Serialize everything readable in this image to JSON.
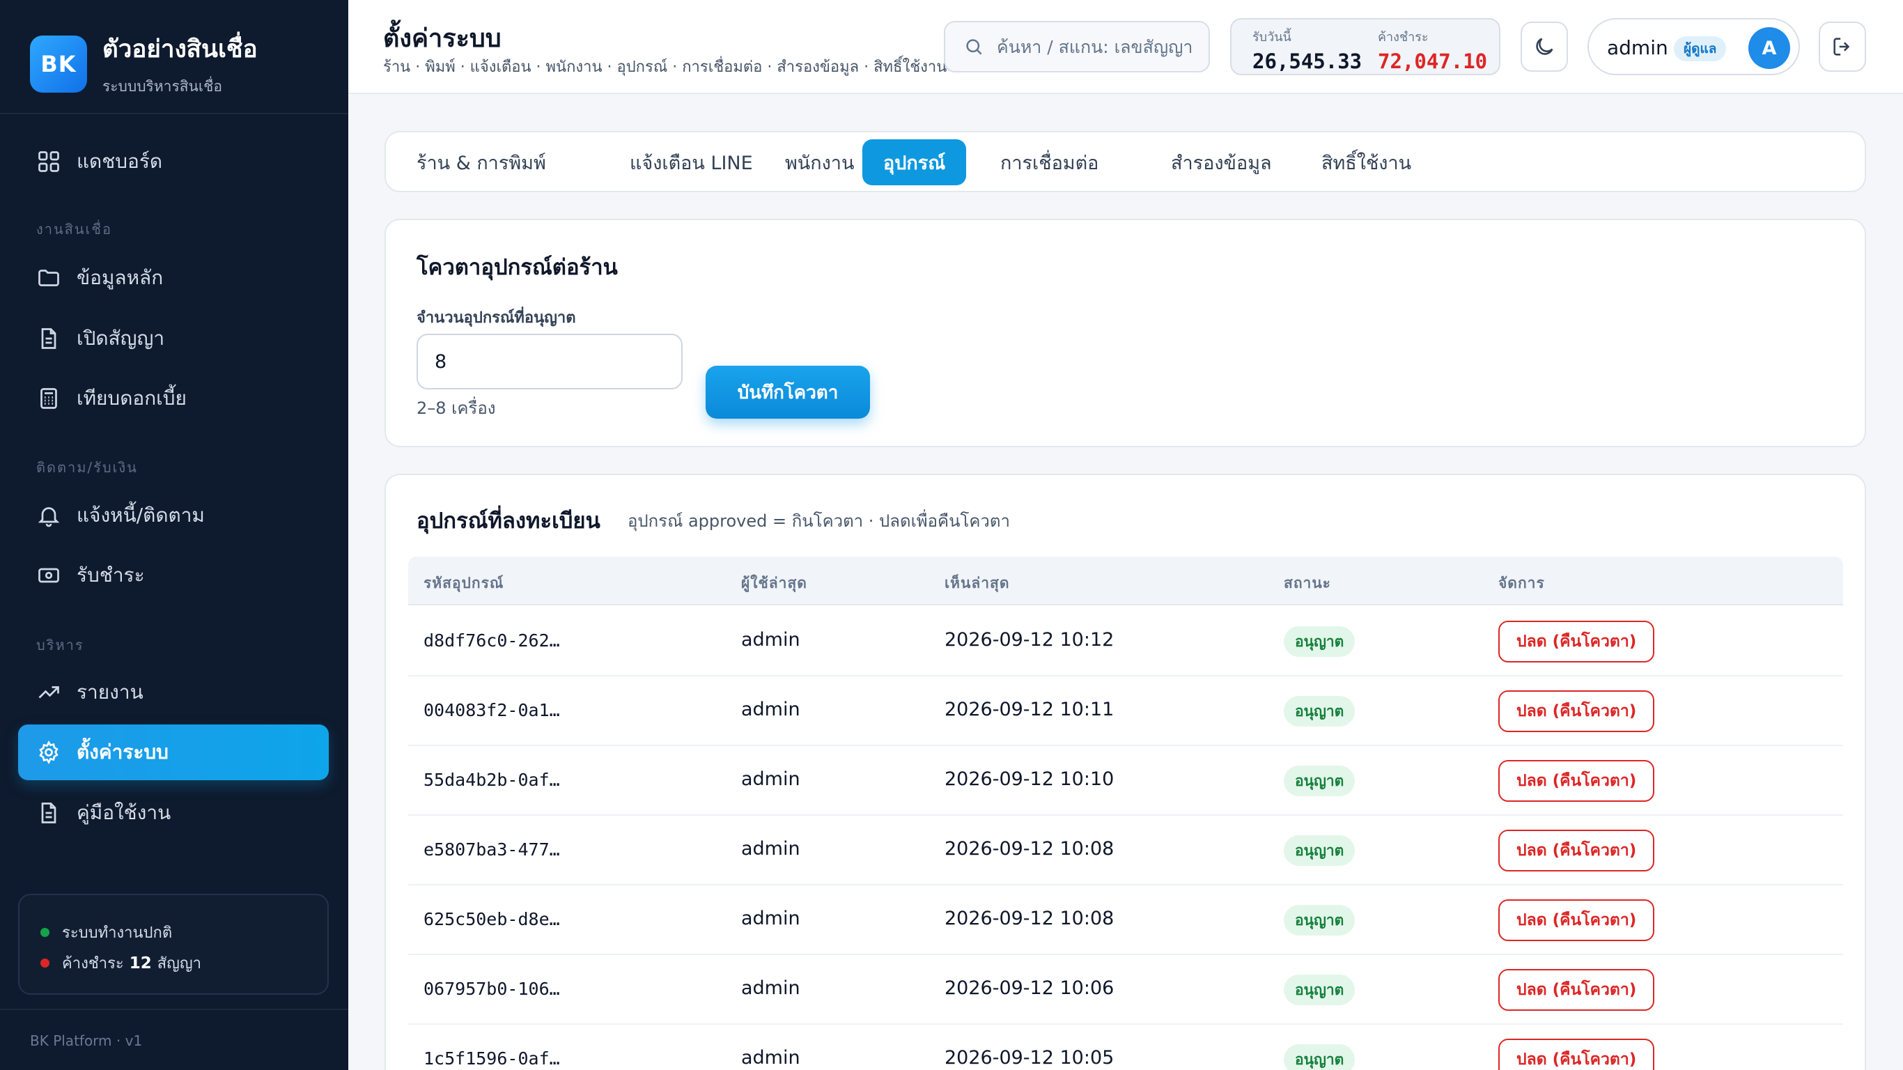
{
  "brand": {
    "logo": "BK",
    "title": "ตัวอย่างสินเชื่อ",
    "subtitle": "ระบบบริหารสินเชื่อ"
  },
  "sidebar": {
    "items": [
      {
        "label": "แดชบอร์ด",
        "icon": "grid-icon"
      },
      {
        "label": "ข้อมูลหลัก",
        "icon": "folder-icon"
      },
      {
        "label": "เปิดสัญญา",
        "icon": "document-icon"
      },
      {
        "label": "เทียบดอกเบี้ย",
        "icon": "calculator-icon"
      },
      {
        "label": "แจ้งหนี้/ติดตาม",
        "icon": "bell-icon"
      },
      {
        "label": "รับชำระ",
        "icon": "cash-icon"
      },
      {
        "label": "รายงาน",
        "icon": "trend-icon"
      },
      {
        "label": "ตั้งค่าระบบ",
        "icon": "gear-icon",
        "active": true
      },
      {
        "label": "คู่มือใช้งาน",
        "icon": "document-icon"
      }
    ],
    "sections": [
      "งานสินเชื่อ",
      "ติดตาม/รับเงิน",
      "บริหาร"
    ],
    "status": {
      "ok_text": "ระบบทำงานปกติ",
      "overdue_prefix": "ค้างชำระ",
      "overdue_count": "12",
      "overdue_suffix": "สัญญา"
    },
    "footer": "BK Platform · v1"
  },
  "header": {
    "title": "ตั้งค่าระบบ",
    "subtitle": "ร้าน · พิมพ์ · แจ้งเตือน · พนักงาน · อุปกรณ์ · การเชื่อมต่อ · สำรองข้อมูล · สิทธิ์ใช้งาน",
    "search_placeholder": "ค้นหา / สแกน: เลขสัญญา",
    "stats": {
      "received_label": "รับวันนี้",
      "received_value": "26,545.33",
      "overdue_label": "ค้างชำระ",
      "overdue_value": "72,047.10"
    },
    "user": {
      "name": "admin",
      "role": "ผู้ดูแล",
      "avatar": "A"
    }
  },
  "tabs": [
    {
      "label": "ร้าน & การพิมพ์"
    },
    {
      "label": "แจ้งเตือน LINE"
    },
    {
      "label": "พนักงาน"
    },
    {
      "label": "อุปกรณ์",
      "active": true
    },
    {
      "label": "การเชื่อมต่อ"
    },
    {
      "label": "สำรองข้อมูล"
    },
    {
      "label": "สิทธิ์ใช้งาน"
    }
  ],
  "quota": {
    "title": "โควตาอุปกรณ์ต่อร้าน",
    "field_label": "จำนวนอุปกรณ์ที่อนุญาต",
    "value": "8",
    "hint": "2–8 เครื่อง",
    "save_label": "บันทึกโควตา"
  },
  "devices": {
    "title": "อุปกรณ์ที่ลงทะเบียน",
    "subtitle": "อุปกรณ์ approved = กินโควตา · ปลดเพื่อคืนโควตา",
    "columns": [
      "รหัสอุปกรณ์",
      "ผู้ใช้ล่าสุด",
      "เห็นล่าสุด",
      "สถานะ",
      "จัดการ"
    ],
    "rows": [
      {
        "id": "d8df76c0-262…",
        "user": "admin",
        "seen": "2026-09-12 10:12",
        "status": "อนุญาต",
        "action": "ปลด (คืนโควตา)"
      },
      {
        "id": "004083f2-0a1…",
        "user": "admin",
        "seen": "2026-09-12 10:11",
        "status": "อนุญาต",
        "action": "ปลด (คืนโควตา)"
      },
      {
        "id": "55da4b2b-0af…",
        "user": "admin",
        "seen": "2026-09-12 10:10",
        "status": "อนุญาต",
        "action": "ปลด (คืนโควตา)"
      },
      {
        "id": "e5807ba3-477…",
        "user": "admin",
        "seen": "2026-09-12 10:08",
        "status": "อนุญาต",
        "action": "ปลด (คืนโควตา)"
      },
      {
        "id": "625c50eb-d8e…",
        "user": "admin",
        "seen": "2026-09-12 10:08",
        "status": "อนุญาต",
        "action": "ปลด (คืนโควตา)"
      },
      {
        "id": "067957b0-106…",
        "user": "admin",
        "seen": "2026-09-12 10:06",
        "status": "อนุญาต",
        "action": "ปลด (คืนโควตา)"
      },
      {
        "id": "1c5f1596-0af…",
        "user": "admin",
        "seen": "2026-09-12 10:05",
        "status": "อนุญาต",
        "action": "ปลด (คืนโควตา)"
      }
    ]
  },
  "colors": {
    "accent": "#0e98e0",
    "sidebar": "#0e1a2d",
    "danger": "#dc2626",
    "success": "#15803d"
  }
}
